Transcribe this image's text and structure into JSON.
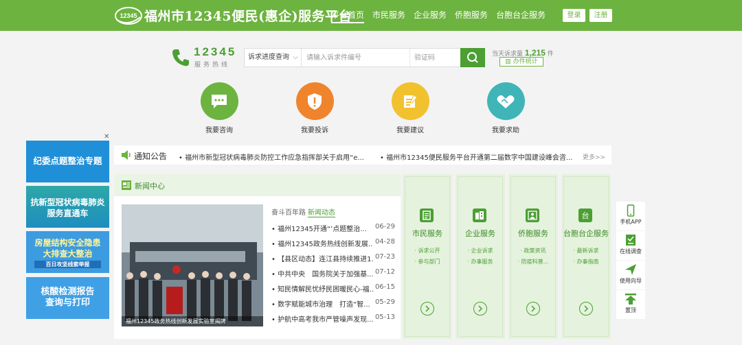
{
  "header": {
    "logo_text": "12345",
    "title": "福州市12345便民(惠企)服务平台",
    "nav": [
      "平台首页",
      "市民服务",
      "企业服务",
      "侨胞服务",
      "台胞台企服务"
    ],
    "login": "登录",
    "register": "注册"
  },
  "hotline": {
    "number": "12345",
    "caption": "服务热线"
  },
  "search": {
    "select": "诉求进度查询",
    "placeholder": "请输入诉求件编号",
    "captcha_placeholder": "验证码"
  },
  "stats": {
    "today_label": "当天诉求量",
    "today_count": "1,215",
    "unit": "件",
    "button": "办件统计"
  },
  "quick": [
    {
      "label": "我要咨询",
      "color": "#6db33f",
      "icon": "chat-icon"
    },
    {
      "label": "我要投诉",
      "color": "#f0842c",
      "icon": "shield-icon"
    },
    {
      "label": "我要建议",
      "color": "#f2c12e",
      "icon": "note-icon"
    },
    {
      "label": "我要求助",
      "color": "#3fb5b8",
      "icon": "handshake-icon"
    }
  ],
  "banners": [
    {
      "text1": "纪委点题整治专题",
      "text2": "",
      "bg": "#1f8fd8"
    },
    {
      "text1": "抗新型冠状病毒肺炎",
      "text2": "服务直通车",
      "bg": "#2ea8a8"
    },
    {
      "text1": "房屋结构安全隐患",
      "text2": "大排查大整治",
      "text3": "百日攻坚线索举报",
      "bg": "#3d9be0"
    },
    {
      "text1": "核酸检测报告",
      "text2": "查询与打印",
      "bg": "#3fa0e5"
    }
  ],
  "notice": {
    "title": "通知公告",
    "items": [
      "福州市新型冠状病毒肺炎防控工作应急指挥部关于启用“e...",
      "福州市12345便民服务平台开通第二届数字中国建设峰会咨..."
    ],
    "more": "更多>>"
  },
  "news": {
    "title": "新闻中心",
    "tabs": [
      "奋斗百年路",
      "新闻动态"
    ],
    "photo_caption": "福州12345政务热线创新发展实验室揭牌",
    "items": [
      {
        "title": "福州12345开通“’点题整治...",
        "date": "06-29"
      },
      {
        "title": "福州12345政务热线创新发展...",
        "date": "04-28"
      },
      {
        "title": "【县区动态】连江县持续推进1...",
        "date": "07-23"
      },
      {
        "title": "中共中央　国务院关于加强基...",
        "date": "07-12"
      },
      {
        "title": "知民情解民忧纾民困暖民心-福...",
        "date": "06-15"
      },
      {
        "title": "数字赋能城市治理　打造“智...",
        "date": "05-29"
      },
      {
        "title": "护航中高考我市严管噪声发现...",
        "date": "05-13"
      }
    ]
  },
  "services": [
    {
      "title": "市民服务",
      "subs": [
        "· 诉求公开",
        "· 参与部门"
      ],
      "glyph": "",
      "icon": "document-icon"
    },
    {
      "title": "企业服务",
      "subs": [
        "· 企业诉求",
        "· 办事服务"
      ],
      "glyph": "",
      "icon": "building-icon"
    },
    {
      "title": "侨胞服务",
      "subs": [
        "· 政策资讯",
        "· 防疫科普..."
      ],
      "glyph": "",
      "icon": "person-icon"
    },
    {
      "title": "台胞台企服务",
      "subs": [
        "· 最新诉求",
        "· 办事指南"
      ],
      "glyph": "台",
      "icon": "taiwan-icon"
    }
  ],
  "tools": [
    {
      "label": "手机APP",
      "icon": "phone-icon"
    },
    {
      "label": "在线调查",
      "icon": "survey-icon"
    },
    {
      "label": "使用向导",
      "icon": "guide-icon"
    },
    {
      "label": "置顶",
      "icon": "top-icon"
    }
  ]
}
